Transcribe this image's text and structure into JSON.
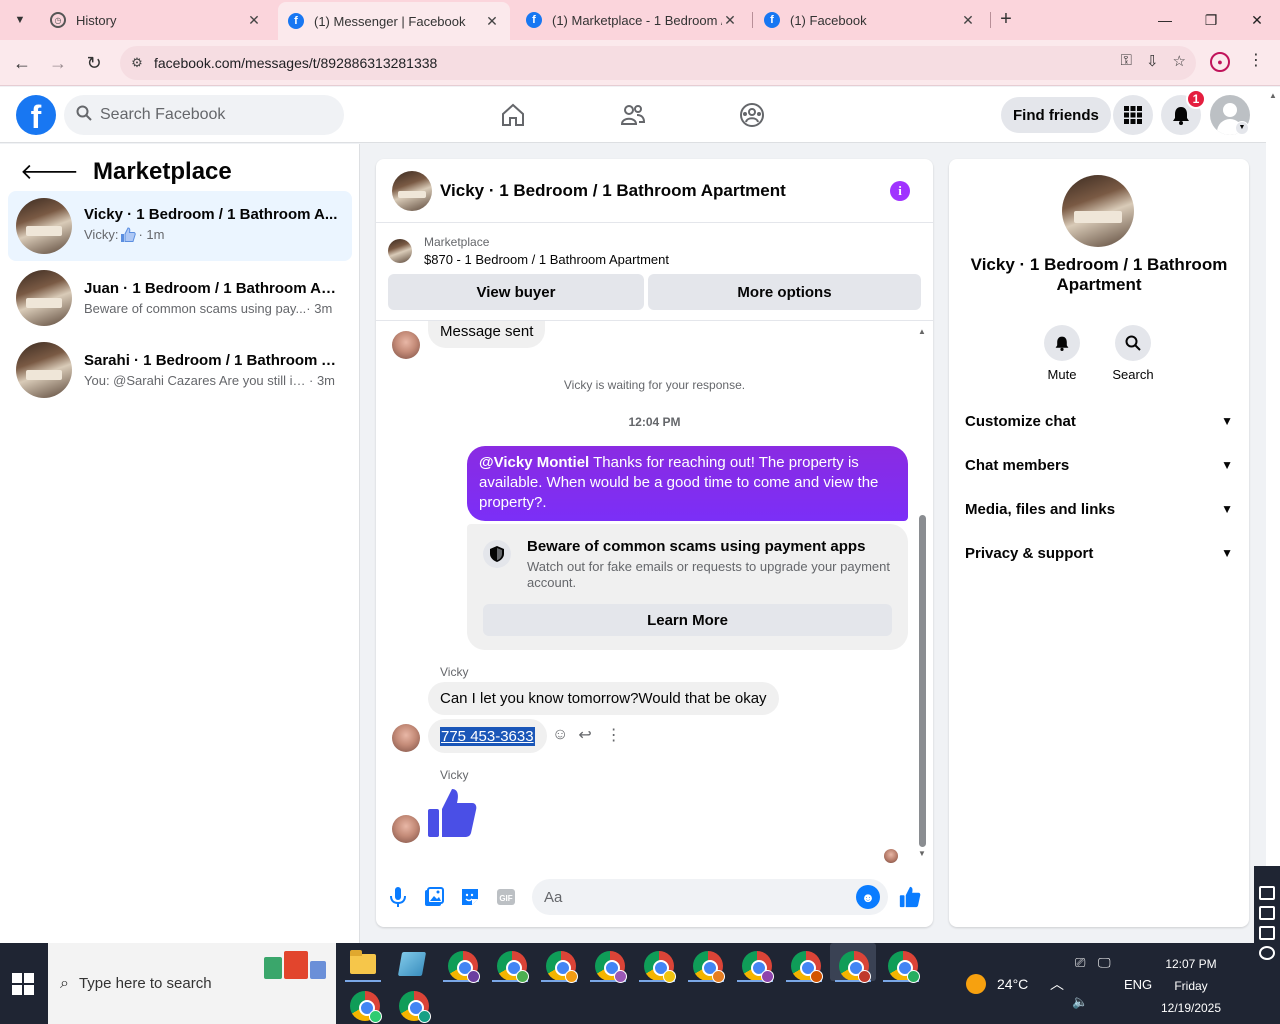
{
  "browser": {
    "tabs": [
      {
        "title": "History"
      },
      {
        "title": "(1) Messenger | Facebook"
      },
      {
        "title": "(1) Marketplace - 1 Bedroom /"
      },
      {
        "title": "(1) Facebook"
      }
    ],
    "url": "facebook.com/messages/t/892886313281338"
  },
  "fb": {
    "search_placeholder": "Search Facebook",
    "find_friends": "Find friends",
    "notification_count": "1"
  },
  "sidebar": {
    "title": "Marketplace",
    "conversations": [
      {
        "name": "Vicky · 1 Bedroom / 1 Bathroom A...",
        "preview": "Vicky: ",
        "has_like": true,
        "time": " · 1m"
      },
      {
        "name": "Juan · 1 Bedroom / 1 Bathroom Ap...",
        "preview": "Beware of common scams using pay...",
        "has_like": false,
        "time": " · 3m"
      },
      {
        "name": "Sarahi · 1 Bedroom / 1 Bathroom A...",
        "preview": "You: @Sarahi Cazares Are you still int...",
        "has_like": false,
        "time": " · 3m"
      }
    ]
  },
  "chat": {
    "title": "Vicky · 1 Bedroom / 1 Bathroom Apartment",
    "marketplace_label": "Marketplace",
    "listing": "$870 - 1 Bedroom / 1 Bathroom Apartment",
    "view_buyer": "View buyer",
    "more_options": "More options",
    "msg_sent": "Message sent",
    "waiting": "Vicky is waiting for your response.",
    "timestamp": "12:04 PM",
    "out_mention": "@Vicky Montiel",
    "out_text": " Thanks for reaching out! The property is available. When would be a good time to come and view the property?.",
    "scam_title": "Beware of common scams using payment apps",
    "scam_desc": "Watch out for fake emails or requests to upgrade your payment account.",
    "learn_more": "Learn More",
    "sender1": "Vicky",
    "msg_tomorrow": "Can I let you know tomorrow?Would that be okay",
    "msg_phone": "775 453-3633",
    "sender2": "Vicky",
    "composer_placeholder": "Aa"
  },
  "details": {
    "name": "Vicky · 1 Bedroom / 1 Bathroom Apartment",
    "mute": "Mute",
    "search": "Search",
    "sections": [
      "Customize chat",
      "Chat members",
      "Media, files and links",
      "Privacy & support"
    ]
  },
  "taskbar": {
    "search_placeholder": "Type here to search",
    "weather": "24°C",
    "lang": "ENG",
    "time": "12:07 PM",
    "day": "Friday",
    "date": "12/19/2025"
  },
  "colors": {
    "facebook_blue": "#1877f2",
    "outgoing_bubble": "#7b2ff7",
    "info_purple": "#a033ff",
    "tab_bar": "#fbd5dc",
    "taskbar": "#1f2533"
  }
}
